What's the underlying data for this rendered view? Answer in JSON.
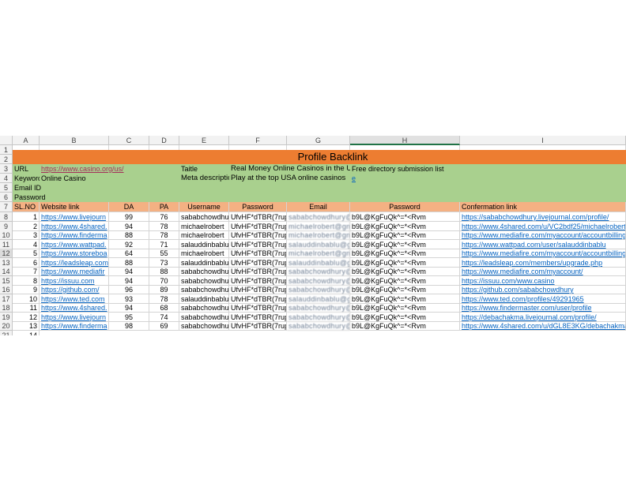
{
  "columns": [
    "A",
    "B",
    "C",
    "D",
    "E",
    "F",
    "G",
    "H",
    "I"
  ],
  "title": "Profile Backlink",
  "info": {
    "url_label": "URL",
    "url_value": "https://www.casino.org/us/",
    "taitle_label": "Taitle",
    "taitle_value": "Real Money Online Casinos in the USA",
    "free_dir": "Free directory submission list",
    "keyword_label": "Keyword",
    "keyword_value": "Online Casino",
    "meta_label": "Meta descriptic",
    "meta_value": "Play at the top USA online casinos",
    "meta_tail": "e",
    "email_label": "Email ID",
    "password_label": "Password"
  },
  "headers": {
    "slno": "SL.NO",
    "website": "Website link",
    "da": "DA",
    "pa": "PA",
    "username": "Username",
    "password": "Password",
    "email": "Email",
    "password2": "Password",
    "confirm": "Confermation link"
  },
  "rows": [
    {
      "n": "8",
      "sl": "1",
      "site": "https://www.livejourn",
      "da": "99",
      "pa": "76",
      "user": "sababchowdhu",
      "pw": "UfvHF*dTBR(7rup/",
      "email": "sababchowdhury@gmail.com",
      "pw2": "b9L@KgFuQk^=*<Rvm",
      "link": "https://sababchowdhury.livejournal.com/profile/"
    },
    {
      "n": "9",
      "sl": "2",
      "site": "https://www.4shared.",
      "da": "94",
      "pa": "78",
      "user": "michaelrobert",
      "pw": "UfvHF*dTBR(7rup/",
      "email": "michaelrobert@gmail.com",
      "pw2": "b9L@KgFuQk^=*<Rvm",
      "link": "https://www.4shared.com/u/VC2bdf25/michaelrobert"
    },
    {
      "n": "10",
      "sl": "3",
      "site": "https://www.finderma",
      "da": "88",
      "pa": "78",
      "user": "michaelrobert",
      "pw": "UfvHF*dTBR(7rup/",
      "email": "michaelrobert@gmail.com",
      "pw2": "b9L@KgFuQk^=*<Rvm",
      "link": "https://www.mediafire.com/myaccount/accountbilling"
    },
    {
      "n": "11",
      "sl": "4",
      "site": "https://www.wattpad.",
      "da": "92",
      "pa": "71",
      "user": "salauddinbablu",
      "pw": "UfvHF*dTBR(7rup/",
      "email": "salauddinbablu@gmail.com",
      "pw2": "b9L@KgFuQk^=*<Rvm",
      "link": "https://www.wattpad.com/user/salauddinbablu"
    },
    {
      "n": "12",
      "sl": "5",
      "site": "https://www.storeboa",
      "da": "64",
      "pa": "55",
      "user": "michaelrobert",
      "pw": "UfvHF*dTBR(7rup/",
      "email": "michaelrobert@gmail.com",
      "pw2": "b9L@KgFuQk^=*<Rvm",
      "link": "https://www.mediafire.com/myaccount/accountbilling"
    },
    {
      "n": "13",
      "sl": "6",
      "site": "https://leadsleap.com",
      "da": "88",
      "pa": "73",
      "user": "salauddinbablu",
      "pw": "UfvHF*dTBR(7rup/",
      "email": "salauddinbablu@gmail.com",
      "pw2": "b9L@KgFuQk^=*<Rvm",
      "link": "https://leadsleap.com/members/upgrade.php"
    },
    {
      "n": "14",
      "sl": "7",
      "site": "https://www.mediafir",
      "da": "94",
      "pa": "88",
      "user": "sababchowdhu",
      "pw": "UfvHF*dTBR(7rup/",
      "email": "sababchowdhury@gmail.com",
      "pw2": "b9L@KgFuQk^=*<Rvm",
      "link": "https://www.mediafire.com/myaccount/"
    },
    {
      "n": "15",
      "sl": "8",
      "site": "https://issuu.com",
      "da": "94",
      "pa": "70",
      "user": "sababchowdhu",
      "pw": "UfvHF*dTBR(7rup/",
      "email": "sababchowdhury@gmail.com",
      "pw2": "b9L@KgFuQk^=*<Rvm",
      "link": "https://issuu.com/www.casino"
    },
    {
      "n": "16",
      "sl": "9",
      "site": "https://github.com/",
      "da": "96",
      "pa": "89",
      "user": "sababchowdhu",
      "pw": "UfvHF*dTBR(7rup/",
      "email": "sababchowdhury@gmail.com",
      "pw2": "b9L@KgFuQk^=*<Rvm",
      "link": "https://github.com/sababchowdhury"
    },
    {
      "n": "17",
      "sl": "10",
      "site": "https://www.ted.com",
      "da": "93",
      "pa": "78",
      "user": "salauddinbablu",
      "pw": "UfvHF*dTBR(7rup/",
      "email": "salauddinbablu@gmail.com",
      "pw2": "b9L@KgFuQk^=*<Rvm",
      "link": "https://www.ted.com/profiles/49291965"
    },
    {
      "n": "18",
      "sl": "11",
      "site": "https://www.4shared.",
      "da": "94",
      "pa": "68",
      "user": "sababchowdhu",
      "pw": "UfvHF*dTBR(7rup/",
      "email": "sababchowdhury@gmail.com",
      "pw2": "b9L@KgFuQk^=*<Rvm",
      "link": "https://www.findermaster.com/user/profile"
    },
    {
      "n": "19",
      "sl": "12",
      "site": "https://www.livejourn",
      "da": "95",
      "pa": "74",
      "user": "sababchowdhu",
      "pw": "UfvHF*dTBR(7rup/",
      "email": "sababchowdhury@gmail.com",
      "pw2": "b9L@KgFuQk^=*<Rvm",
      "link": "https://debachakma.livejournal.com/profile/"
    },
    {
      "n": "20",
      "sl": "13",
      "site": "https://www.finderma",
      "da": "98",
      "pa": "69",
      "user": "sababchowdhu",
      "pw": "UfvHF*dTBR(7rup/",
      "email": "sababchowdhury@gmail.com",
      "pw2": "b9L@KgFuQk^=*<Rvm",
      "link": "https://www.4shared.com/u/dGL8E3KG/debachakma"
    }
  ],
  "extra_row": {
    "n": "21",
    "sl": "14"
  },
  "row_numbers": {
    "r1": "1",
    "r2": "2",
    "r3": "3",
    "r4": "4",
    "r5": "5",
    "r6": "6",
    "r7": "7"
  },
  "colors": {
    "title_bg": "#ed7d31",
    "info_bg": "#a9d08e",
    "header_bg": "#f4b183",
    "link": "#0563c1"
  }
}
